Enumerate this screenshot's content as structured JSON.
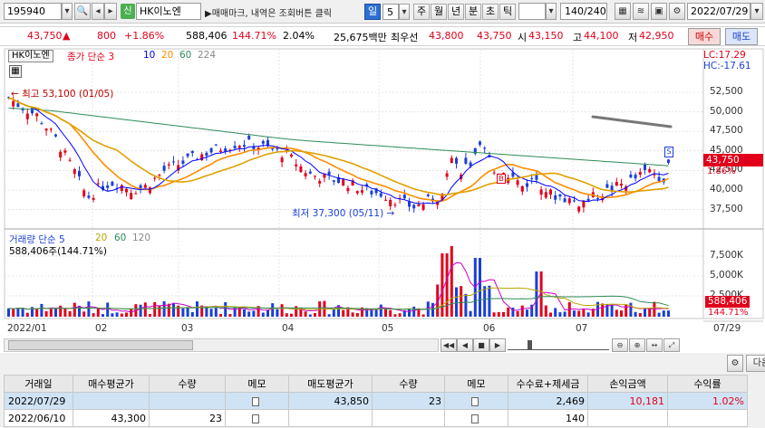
{
  "toolbar": {
    "code": "195940",
    "name_badge": "신",
    "stock_name": "HK이노엔",
    "hint": "▶매매마크, 내역은 조회버튼 클릭",
    "periods": [
      "일",
      "5",
      "주",
      "월",
      "년",
      "분",
      "초",
      "틱"
    ],
    "period_selected": "일",
    "period_value": "5",
    "count": "140",
    "count_total": "/240",
    "date": "2022/07/29"
  },
  "quote": {
    "price": "43,750",
    "arrow": "▲",
    "change": "800",
    "change_pct": "+1.86%",
    "volume": "588,406",
    "volume_pct": "144.71%",
    "turnover": "2.04%",
    "amount": "25,675백만",
    "best_label": "최우선",
    "best_ask": "43,800",
    "best_bid": "43,750",
    "open_label": "시",
    "open": "43,150",
    "high_label": "고",
    "high": "44,100",
    "low_label": "저",
    "low": "42,950",
    "buy_label": "매수",
    "sell_label": "매도"
  },
  "chart": {
    "legend_name": "HK이노엔",
    "legend_ma": [
      "종가 단순 3",
      "10",
      "20",
      "60",
      "224"
    ],
    "lc": "LC:17.29",
    "hc": "HC:-17.61",
    "price_ticks": [
      "52,500",
      "50,000",
      "47,500",
      "45,000",
      "42,500",
      "40,000",
      "37,500"
    ],
    "current_price": "43,750",
    "current_pct": "1.86%",
    "high_note": "최고 53,100 (01/05)",
    "low_note": "최저 37,300 (05/11)",
    "vol_legend": [
      "거래량 단순 5",
      "20",
      "60",
      "120"
    ],
    "vol_value": "588,406주(144.71%)",
    "vol_ticks": [
      "7,500K",
      "5,000K",
      "2,500K"
    ],
    "vol_current": "588,406",
    "vol_pct": "144.71%",
    "x_labels": [
      "2022/01",
      "02",
      "03",
      "04",
      "05",
      "06",
      "07",
      "07/29"
    ],
    "marker_b": "B",
    "marker_s": "S"
  },
  "colors": {
    "up": "#e0001b",
    "down": "#1a3fd6",
    "ma3": "#0000ff",
    "ma10": "#ff8c00",
    "ma20": "#b8a800",
    "ma60": "#2e8b57",
    "ma224": "#9a9a9a"
  },
  "panel": {
    "next_label": "다음"
  },
  "table": {
    "headers": [
      "거래일",
      "매수평균가",
      "수량",
      "메모",
      "매도평균가",
      "수량",
      "메모",
      "수수료+제세금",
      "손익금액",
      "수익률"
    ],
    "rows": [
      [
        "2022/07/29",
        "",
        "",
        "memo",
        "43,850",
        "23",
        "memo",
        "2,469",
        "10,181",
        "1.02%"
      ],
      [
        "2022/06/10",
        "43,300",
        "23",
        "memo",
        "",
        "",
        "memo",
        "140",
        "",
        ""
      ]
    ]
  }
}
